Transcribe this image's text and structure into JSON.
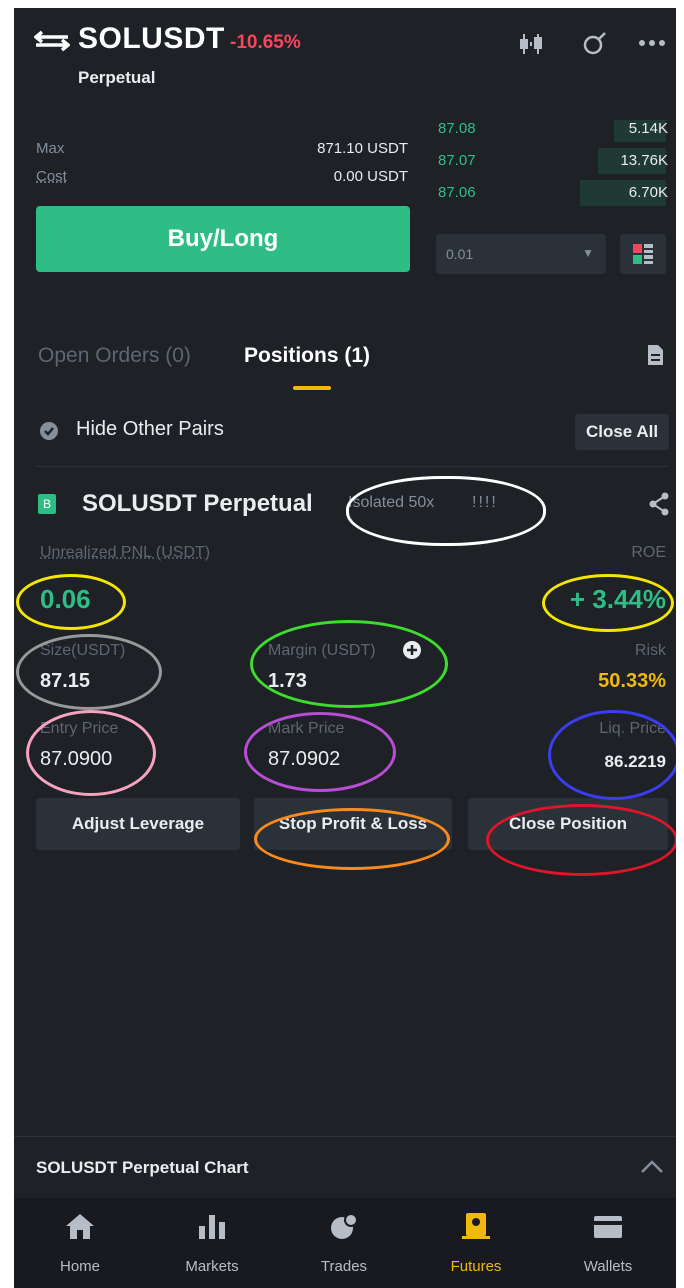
{
  "header": {
    "symbol": "SOLUSDT",
    "change": "-10.65%",
    "subtitle": "Perpetual"
  },
  "order_panel": {
    "max_label": "Max",
    "max_value": "871.10 USDT",
    "cost_label": "Cost",
    "cost_value": "0.00 USDT",
    "buy_label": "Buy/Long",
    "precision_value": "0.01"
  },
  "order_book": [
    {
      "price": "87.08",
      "qty": "5.14K"
    },
    {
      "price": "87.07",
      "qty": "13.76K"
    },
    {
      "price": "87.06",
      "qty": "6.70K"
    }
  ],
  "tabs": {
    "open_orders": "Open Orders (0)",
    "positions": "Positions (1)"
  },
  "filters": {
    "hide_other_pairs": "Hide Other Pairs",
    "close_all": "Close All"
  },
  "position": {
    "badge": "B",
    "title": "SOLUSDT Perpetual",
    "margin_mode": "Isolated 50x",
    "strength": "!!!!",
    "unrealized_pnl_label": "Unrealized PNL (USDT)",
    "unrealized_pnl_value": "0.06",
    "roe_label": "ROE",
    "roe_value": "+ 3.44%",
    "size_label": "Size(USDT)",
    "size_value": "87.15",
    "margin_label": "Margin (USDT)",
    "margin_value": "1.73",
    "risk_label": "Risk",
    "risk_value": "50.33%",
    "entry_price_label": "Entry Price",
    "entry_price_value": "87.0900",
    "mark_price_label": "Mark Price",
    "mark_price_value": "87.0902",
    "liq_price_label": "Liq. Price",
    "liq_price_value": "86.2219"
  },
  "actions": {
    "adjust_leverage": "Adjust Leverage",
    "stop_profit_loss": "Stop Profit & Loss",
    "close_position": "Close Position"
  },
  "chart_bar": {
    "label": "SOLUSDT Perpetual  Chart"
  },
  "nav": [
    {
      "label": "Home",
      "icon": "home-icon"
    },
    {
      "label": "Markets",
      "icon": "markets-icon"
    },
    {
      "label": "Trades",
      "icon": "trades-icon"
    },
    {
      "label": "Futures",
      "icon": "futures-icon",
      "active": true
    },
    {
      "label": "Wallets",
      "icon": "wallets-icon"
    }
  ],
  "colors": {
    "background": "#1e2126",
    "buy_green": "#2ebd85",
    "sell_red": "#f6465d",
    "accent_yellow": "#f0b90b",
    "annotation_white": "#ffffff",
    "annotation_yellow": "#f3e600",
    "annotation_gray": "#9a9a9a",
    "annotation_green": "#3ddc2e",
    "annotation_pink": "#f7a3c0",
    "annotation_purple": "#b94ed6",
    "annotation_blue": "#3b3df0",
    "annotation_orange": "#ff8a1c",
    "annotation_red": "#e0142a"
  }
}
